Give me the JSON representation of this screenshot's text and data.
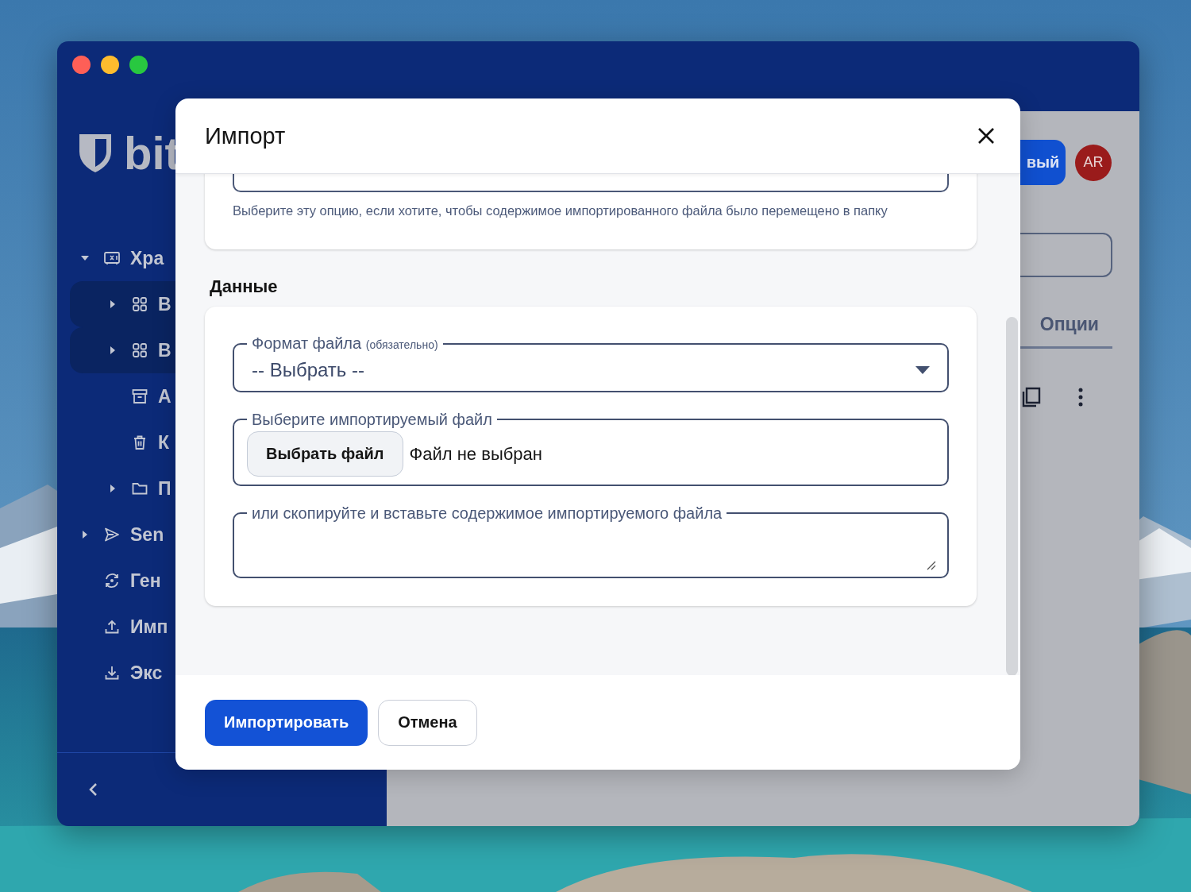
{
  "sidebar": {
    "logo_text": "bit",
    "items": [
      {
        "label": "Хра",
        "kind": "vault",
        "expanded": true,
        "selected": false,
        "children": [
          {
            "label": "В",
            "kind": "collection",
            "expanded": false,
            "selected": true
          },
          {
            "label": "В",
            "kind": "collection",
            "expanded": false,
            "selected": true
          },
          {
            "label": "А",
            "kind": "archive",
            "selected": false
          },
          {
            "label": "К",
            "kind": "trash",
            "selected": false
          },
          {
            "label": "П",
            "kind": "folder",
            "expanded": false,
            "selected": false
          }
        ]
      },
      {
        "label": "Sen",
        "kind": "send",
        "expanded": false,
        "selected": false
      },
      {
        "label": "Ген",
        "kind": "generator",
        "selected": false
      },
      {
        "label": "Имп",
        "kind": "import",
        "selected": false
      },
      {
        "label": "Экс",
        "kind": "export",
        "selected": false
      }
    ]
  },
  "header": {
    "new_button": "вый",
    "avatar": "AR"
  },
  "tabs": [
    {
      "label": "Опции",
      "selected": true
    }
  ],
  "dialog": {
    "title": "Импорт",
    "folder_hint": "Выберите эту опцию, если хотите, чтобы содержимое импортированного файла было перемещено в папку",
    "section_title": "Данные",
    "file_format": {
      "label": "Формат файла",
      "required_note": "(обязательно)",
      "value": "-- Выбрать --"
    },
    "file_input": {
      "label": "Выберите импортируемый файл",
      "button": "Выбрать файл",
      "status": "Файл не выбран"
    },
    "paste": {
      "label": "или скопируйте и вставьте содержимое импортируемого файла"
    },
    "buttons": [
      {
        "label": "Импортировать",
        "kind": "primary"
      },
      {
        "label": "Отмена",
        "kind": "secondary"
      }
    ]
  }
}
